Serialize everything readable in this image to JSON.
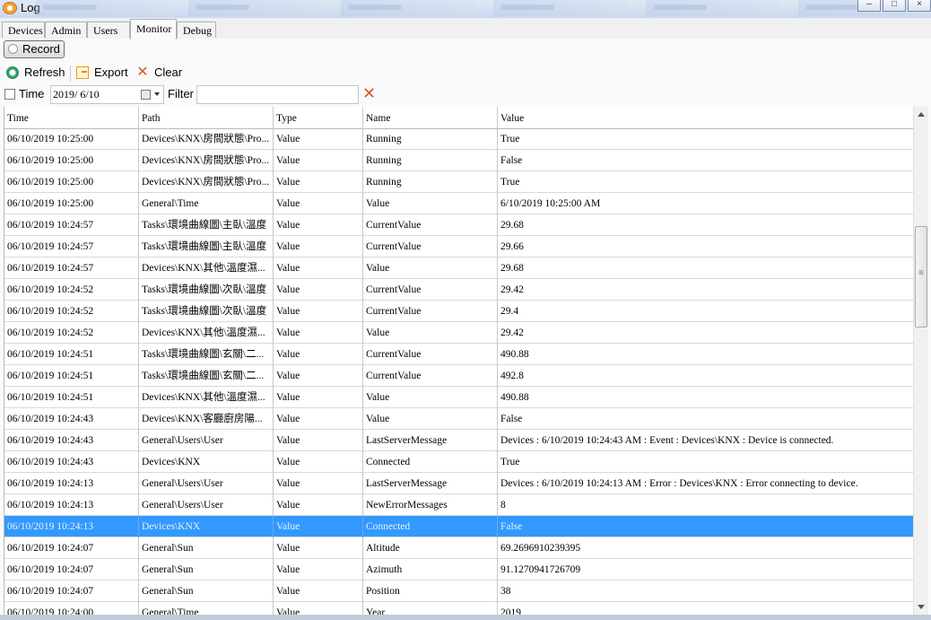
{
  "window": {
    "title": "Log",
    "minimize_icon": "minimize-icon",
    "maximize_icon": "maximize-icon",
    "close_icon": "close-icon"
  },
  "tabs": [
    {
      "label": "Devices",
      "active": false
    },
    {
      "label": "Admin",
      "active": false
    },
    {
      "label": "Users",
      "active": false
    },
    {
      "label": "Monitor",
      "active": true
    },
    {
      "label": "Debug",
      "active": false
    }
  ],
  "record_button": {
    "label": "Record",
    "icon": "record-dot-icon"
  },
  "toolbar": {
    "refresh_label": "Refresh",
    "export_label": "Export",
    "clear_label": "Clear"
  },
  "filter": {
    "time_label": "Time",
    "time_checked": false,
    "date_value": "2019/ 6/10",
    "filter_label": "Filter",
    "filter_value": ""
  },
  "grid": {
    "columns": [
      "Time",
      "Path",
      "Type",
      "Name",
      "Value"
    ],
    "selected_row": 18,
    "rows": [
      [
        "06/10/2019 10:25:00",
        "Devices\\KNX\\房間狀態\\Pro...",
        "Value",
        "Running",
        "True"
      ],
      [
        "06/10/2019 10:25:00",
        "Devices\\KNX\\房間狀態\\Pro...",
        "Value",
        "Running",
        "False"
      ],
      [
        "06/10/2019 10:25:00",
        "Devices\\KNX\\房間狀態\\Pro...",
        "Value",
        "Running",
        "True"
      ],
      [
        "06/10/2019 10:25:00",
        "General\\Time",
        "Value",
        "Value",
        "6/10/2019 10:25:00 AM"
      ],
      [
        "06/10/2019 10:24:57",
        "Tasks\\環境曲線圖\\主臥\\溫度",
        "Value",
        "CurrentValue",
        "29.68"
      ],
      [
        "06/10/2019 10:24:57",
        "Tasks\\環境曲線圖\\主臥\\溫度",
        "Value",
        "CurrentValue",
        "29.66"
      ],
      [
        "06/10/2019 10:24:57",
        "Devices\\KNX\\其他\\溫度濕...",
        "Value",
        "Value",
        "29.68"
      ],
      [
        "06/10/2019 10:24:52",
        "Tasks\\環境曲線圖\\次臥\\溫度",
        "Value",
        "CurrentValue",
        "29.42"
      ],
      [
        "06/10/2019 10:24:52",
        "Tasks\\環境曲線圖\\次臥\\溫度",
        "Value",
        "CurrentValue",
        "29.4"
      ],
      [
        "06/10/2019 10:24:52",
        "Devices\\KNX\\其他\\溫度濕...",
        "Value",
        "Value",
        "29.42"
      ],
      [
        "06/10/2019 10:24:51",
        "Tasks\\環境曲線圖\\玄關\\二...",
        "Value",
        "CurrentValue",
        "490.88"
      ],
      [
        "06/10/2019 10:24:51",
        "Tasks\\環境曲線圖\\玄關\\二...",
        "Value",
        "CurrentValue",
        "492.8"
      ],
      [
        "06/10/2019 10:24:51",
        "Devices\\KNX\\其他\\溫度濕...",
        "Value",
        "Value",
        "490.88"
      ],
      [
        "06/10/2019 10:24:43",
        "Devices\\KNX\\客廳廚房陽...",
        "Value",
        "Value",
        "False"
      ],
      [
        "06/10/2019 10:24:43",
        "General\\Users\\User",
        "Value",
        "LastServerMessage",
        "Devices : 6/10/2019 10:24:43 AM : Event : Devices\\KNX : Device is connected."
      ],
      [
        "06/10/2019 10:24:43",
        "Devices\\KNX",
        "Value",
        "Connected",
        "True"
      ],
      [
        "06/10/2019 10:24:13",
        "General\\Users\\User",
        "Value",
        "LastServerMessage",
        "Devices : 6/10/2019 10:24:13 AM : Error : Devices\\KNX : Error connecting to device."
      ],
      [
        "06/10/2019 10:24:13",
        "General\\Users\\User",
        "Value",
        "NewErrorMessages",
        "8"
      ],
      [
        "06/10/2019 10:24:13",
        "Devices\\KNX",
        "Value",
        "Connected",
        "False"
      ],
      [
        "06/10/2019 10:24:07",
        "General\\Sun",
        "Value",
        "Altitude",
        "69.2696910239395"
      ],
      [
        "06/10/2019 10:24:07",
        "General\\Sun",
        "Value",
        "Azimuth",
        "91.1270941726709"
      ],
      [
        "06/10/2019 10:24:07",
        "General\\Sun",
        "Value",
        "Position",
        "38"
      ],
      [
        "06/10/2019 10:24:00",
        "General\\Time",
        "Value",
        "Year",
        "2019"
      ]
    ]
  }
}
